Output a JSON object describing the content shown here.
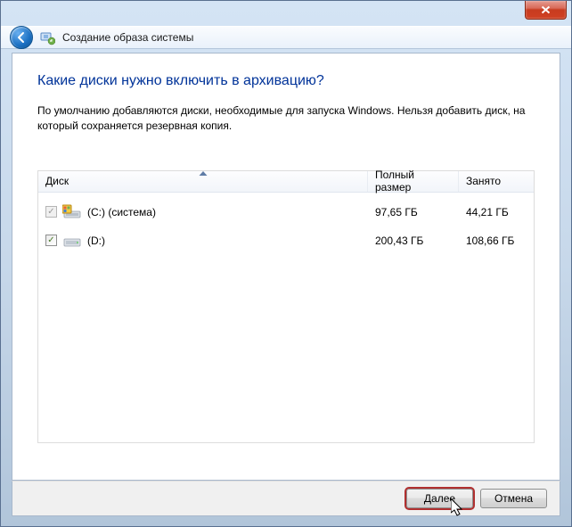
{
  "titlebar": {},
  "header": {
    "title": "Создание образа системы"
  },
  "main": {
    "heading": "Какие диски нужно включить в архивацию?",
    "description": "По умолчанию добавляются диски, необходимые для запуска Windows. Нельзя добавить диск, на который сохраняется резервная копия."
  },
  "table": {
    "columns": {
      "disk": "Диск",
      "total": "Полный размер",
      "used": "Занято"
    },
    "rows": [
      {
        "label": "(C:) (система)",
        "total": "97,65 ГБ",
        "used": "44,21 ГБ",
        "checked": true,
        "disabled": true,
        "system": true
      },
      {
        "label": "(D:)",
        "total": "200,43 ГБ",
        "used": "108,66 ГБ",
        "checked": true,
        "disabled": false,
        "system": false
      }
    ]
  },
  "footer": {
    "next": "Далее",
    "cancel": "Отмена"
  }
}
